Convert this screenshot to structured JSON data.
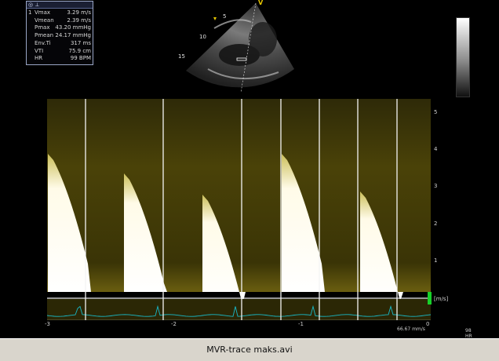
{
  "measurements": {
    "header_icons": [
      "circle-icon",
      "ruler-icon"
    ],
    "items": [
      {
        "index": "1",
        "label": "Vmax",
        "value": "3.29 m/s"
      },
      {
        "index": "",
        "label": "Vmean",
        "value": "2.39 m/s"
      },
      {
        "index": "",
        "label": "Pmax",
        "value": "43.20 mmHg"
      },
      {
        "index": "",
        "label": "Pmean",
        "value": "24.17 mmHg"
      },
      {
        "index": "",
        "label": "Env.Ti",
        "value": "317 ms"
      },
      {
        "index": "",
        "label": "VTI",
        "value": "75.9 cm"
      },
      {
        "index": "",
        "label": "HR",
        "value": "99 BPM"
      }
    ]
  },
  "echo": {
    "probe_marker": "V",
    "depth_labels": [
      "5",
      "10",
      "15"
    ]
  },
  "doppler": {
    "velocity_ticks": [
      "5",
      "4",
      "3",
      "2",
      "1"
    ],
    "unit": "[m/s]",
    "time_ticks": [
      "-3",
      "-2",
      "-1",
      "0"
    ],
    "sweep_speed": "66.67 mm/s",
    "hr_value": "98",
    "hr_label": "HR"
  },
  "file": {
    "name": "MVR-trace maks.avi"
  }
}
